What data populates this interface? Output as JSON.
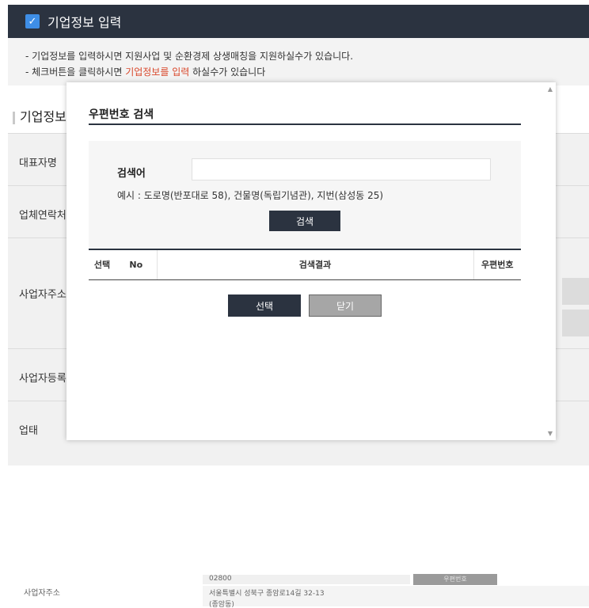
{
  "background": {
    "header_title": "기업정보 입력",
    "notice_lines": {
      "line1": "- 기업정보를 입력하시면 지원사업 및 순환경제 상생매칭을 지원하실수가 있습니다.",
      "line2_prefix": "- 체크버튼을 클릭하시면 ",
      "line2_highlight": "기업정보를 입력",
      "line2_suffix": " 하실수가 있습니다"
    },
    "section_title": "기업정보",
    "form_labels": {
      "rep_name": "대표자명",
      "contact": "업체연락처",
      "address": "사업자주소",
      "reg_no": "사업자등록",
      "business_type": "업태"
    }
  },
  "modal": {
    "title": "우편번호 검색",
    "search_label": "검색어",
    "search_value": "",
    "search_placeholder": "",
    "example": "예시 : 도로명(반포대로 58), 건물명(독립기념관), 지번(삼성동 25)",
    "search_button": "검색",
    "table_headers": {
      "select": "선택",
      "no": "No",
      "result": "검색결과",
      "zip": "우편번호"
    },
    "select_button": "선택",
    "close_button": "닫기"
  },
  "fragment": {
    "label": "사업자주소",
    "zip": "02800",
    "zip_button": "우편번호",
    "address_line1": "서울특별시 성북구 종암로14길 32-13",
    "address_line2": "(종암동)"
  },
  "colors": {
    "navy": "#2b3340",
    "accent_red": "#d9472b",
    "checkbox_blue": "#3e8ee6"
  }
}
